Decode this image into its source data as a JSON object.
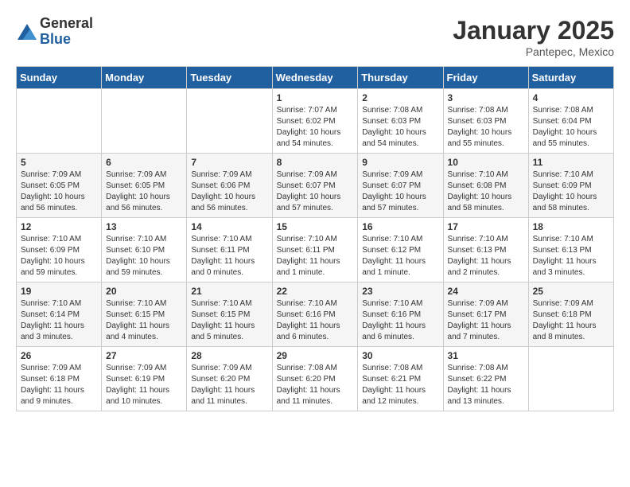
{
  "logo": {
    "general": "General",
    "blue": "Blue"
  },
  "title": "January 2025",
  "location": "Pantepec, Mexico",
  "weekdays": [
    "Sunday",
    "Monday",
    "Tuesday",
    "Wednesday",
    "Thursday",
    "Friday",
    "Saturday"
  ],
  "weeks": [
    [
      {
        "day": "",
        "info": ""
      },
      {
        "day": "",
        "info": ""
      },
      {
        "day": "",
        "info": ""
      },
      {
        "day": "1",
        "info": "Sunrise: 7:07 AM\nSunset: 6:02 PM\nDaylight: 10 hours\nand 54 minutes."
      },
      {
        "day": "2",
        "info": "Sunrise: 7:08 AM\nSunset: 6:03 PM\nDaylight: 10 hours\nand 54 minutes."
      },
      {
        "day": "3",
        "info": "Sunrise: 7:08 AM\nSunset: 6:03 PM\nDaylight: 10 hours\nand 55 minutes."
      },
      {
        "day": "4",
        "info": "Sunrise: 7:08 AM\nSunset: 6:04 PM\nDaylight: 10 hours\nand 55 minutes."
      }
    ],
    [
      {
        "day": "5",
        "info": "Sunrise: 7:09 AM\nSunset: 6:05 PM\nDaylight: 10 hours\nand 56 minutes."
      },
      {
        "day": "6",
        "info": "Sunrise: 7:09 AM\nSunset: 6:05 PM\nDaylight: 10 hours\nand 56 minutes."
      },
      {
        "day": "7",
        "info": "Sunrise: 7:09 AM\nSunset: 6:06 PM\nDaylight: 10 hours\nand 56 minutes."
      },
      {
        "day": "8",
        "info": "Sunrise: 7:09 AM\nSunset: 6:07 PM\nDaylight: 10 hours\nand 57 minutes."
      },
      {
        "day": "9",
        "info": "Sunrise: 7:09 AM\nSunset: 6:07 PM\nDaylight: 10 hours\nand 57 minutes."
      },
      {
        "day": "10",
        "info": "Sunrise: 7:10 AM\nSunset: 6:08 PM\nDaylight: 10 hours\nand 58 minutes."
      },
      {
        "day": "11",
        "info": "Sunrise: 7:10 AM\nSunset: 6:09 PM\nDaylight: 10 hours\nand 58 minutes."
      }
    ],
    [
      {
        "day": "12",
        "info": "Sunrise: 7:10 AM\nSunset: 6:09 PM\nDaylight: 10 hours\nand 59 minutes."
      },
      {
        "day": "13",
        "info": "Sunrise: 7:10 AM\nSunset: 6:10 PM\nDaylight: 10 hours\nand 59 minutes."
      },
      {
        "day": "14",
        "info": "Sunrise: 7:10 AM\nSunset: 6:11 PM\nDaylight: 11 hours\nand 0 minutes."
      },
      {
        "day": "15",
        "info": "Sunrise: 7:10 AM\nSunset: 6:11 PM\nDaylight: 11 hours\nand 1 minute."
      },
      {
        "day": "16",
        "info": "Sunrise: 7:10 AM\nSunset: 6:12 PM\nDaylight: 11 hours\nand 1 minute."
      },
      {
        "day": "17",
        "info": "Sunrise: 7:10 AM\nSunset: 6:13 PM\nDaylight: 11 hours\nand 2 minutes."
      },
      {
        "day": "18",
        "info": "Sunrise: 7:10 AM\nSunset: 6:13 PM\nDaylight: 11 hours\nand 3 minutes."
      }
    ],
    [
      {
        "day": "19",
        "info": "Sunrise: 7:10 AM\nSunset: 6:14 PM\nDaylight: 11 hours\nand 3 minutes."
      },
      {
        "day": "20",
        "info": "Sunrise: 7:10 AM\nSunset: 6:15 PM\nDaylight: 11 hours\nand 4 minutes."
      },
      {
        "day": "21",
        "info": "Sunrise: 7:10 AM\nSunset: 6:15 PM\nDaylight: 11 hours\nand 5 minutes."
      },
      {
        "day": "22",
        "info": "Sunrise: 7:10 AM\nSunset: 6:16 PM\nDaylight: 11 hours\nand 6 minutes."
      },
      {
        "day": "23",
        "info": "Sunrise: 7:10 AM\nSunset: 6:16 PM\nDaylight: 11 hours\nand 6 minutes."
      },
      {
        "day": "24",
        "info": "Sunrise: 7:09 AM\nSunset: 6:17 PM\nDaylight: 11 hours\nand 7 minutes."
      },
      {
        "day": "25",
        "info": "Sunrise: 7:09 AM\nSunset: 6:18 PM\nDaylight: 11 hours\nand 8 minutes."
      }
    ],
    [
      {
        "day": "26",
        "info": "Sunrise: 7:09 AM\nSunset: 6:18 PM\nDaylight: 11 hours\nand 9 minutes."
      },
      {
        "day": "27",
        "info": "Sunrise: 7:09 AM\nSunset: 6:19 PM\nDaylight: 11 hours\nand 10 minutes."
      },
      {
        "day": "28",
        "info": "Sunrise: 7:09 AM\nSunset: 6:20 PM\nDaylight: 11 hours\nand 11 minutes."
      },
      {
        "day": "29",
        "info": "Sunrise: 7:08 AM\nSunset: 6:20 PM\nDaylight: 11 hours\nand 11 minutes."
      },
      {
        "day": "30",
        "info": "Sunrise: 7:08 AM\nSunset: 6:21 PM\nDaylight: 11 hours\nand 12 minutes."
      },
      {
        "day": "31",
        "info": "Sunrise: 7:08 AM\nSunset: 6:22 PM\nDaylight: 11 hours\nand 13 minutes."
      },
      {
        "day": "",
        "info": ""
      }
    ]
  ]
}
